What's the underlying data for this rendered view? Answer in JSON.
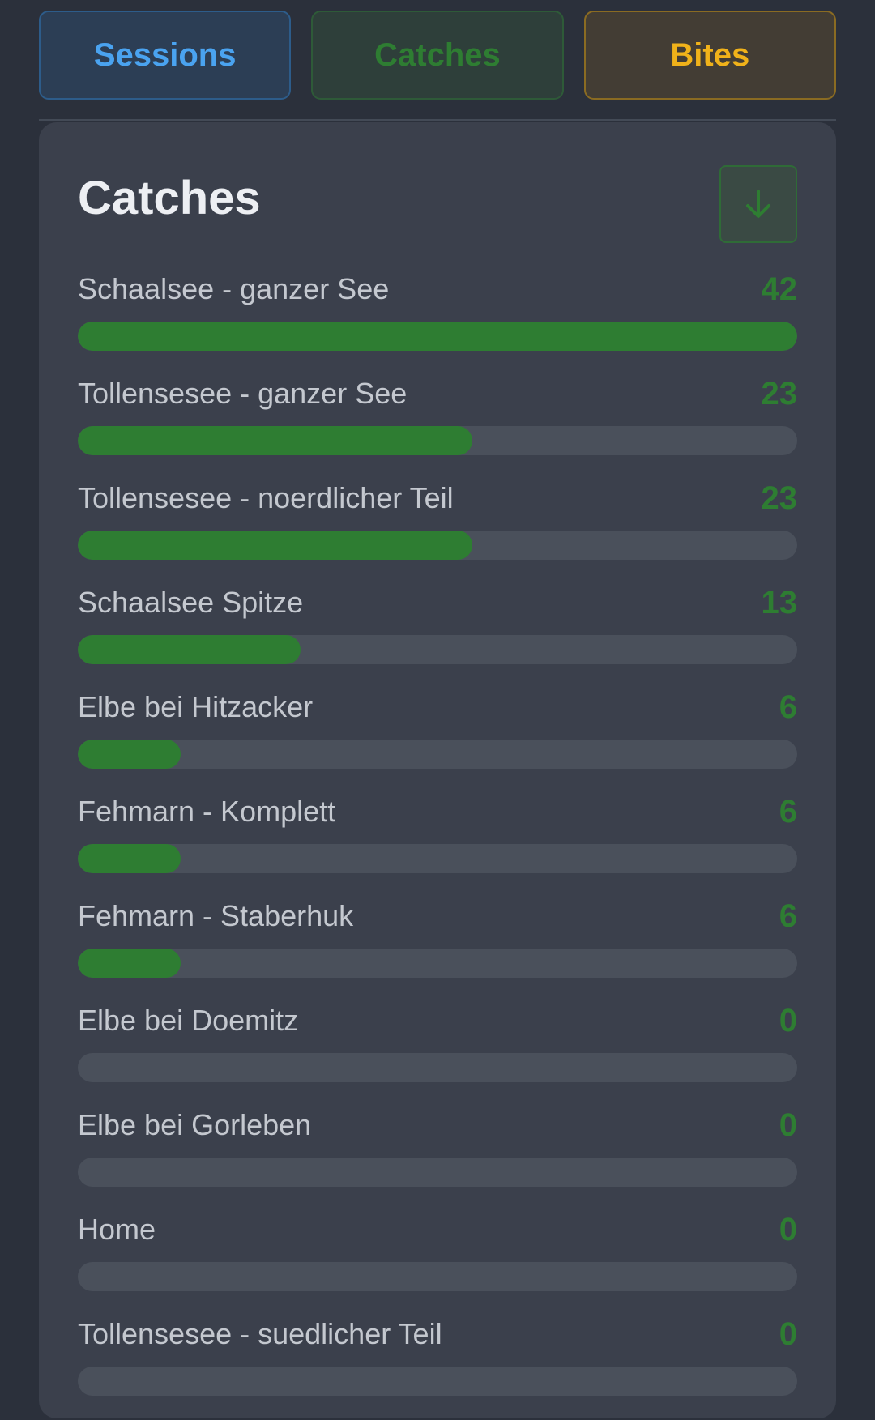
{
  "tabs": [
    {
      "label": "Sessions"
    },
    {
      "label": "Catches"
    },
    {
      "label": "Bites"
    }
  ],
  "card": {
    "title": "Catches",
    "download_icon": "arrow-down-icon"
  },
  "colors": {
    "sessions": "#4aa3f0",
    "catches": "#2e7d32",
    "bites": "#f0b21a",
    "bar_fill": "#2e7d32",
    "bar_track": "#4a505b"
  },
  "rows": [
    {
      "label": "Schaalsee - ganzer See",
      "value": "42",
      "progress": 1.0
    },
    {
      "label": "Tollensesee - ganzer See",
      "value": "23",
      "progress": 0.548
    },
    {
      "label": "Tollensesee - noerdlicher Teil",
      "value": "23",
      "progress": 0.548
    },
    {
      "label": "Schaalsee Spitze",
      "value": "13",
      "progress": 0.31
    },
    {
      "label": "Elbe bei Hitzacker",
      "value": "6",
      "progress": 0.143
    },
    {
      "label": "Fehmarn - Komplett",
      "value": "6",
      "progress": 0.143
    },
    {
      "label": "Fehmarn - Staberhuk",
      "value": "6",
      "progress": 0.143
    },
    {
      "label": "Elbe bei Doemitz",
      "value": "0",
      "progress": 0
    },
    {
      "label": "Elbe bei Gorleben",
      "value": "0",
      "progress": 0
    },
    {
      "label": "Home",
      "value": "0",
      "progress": 0
    },
    {
      "label": "Tollensesee - suedlicher Teil",
      "value": "0",
      "progress": 0
    }
  ]
}
